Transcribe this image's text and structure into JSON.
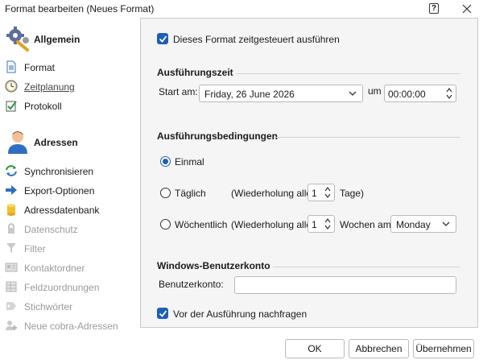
{
  "window": {
    "title": "Format bearbeiten (Neues Format)",
    "help_label": "?"
  },
  "sidebar": {
    "groups": [
      {
        "label": "Allgemein",
        "icon": "gear-wrench-icon",
        "items": [
          {
            "label": "Format",
            "icon": "document-icon",
            "state": "normal"
          },
          {
            "label": "Zeitplanung",
            "icon": "clock-icon",
            "state": "active"
          },
          {
            "label": "Protokoll",
            "icon": "checklist-icon",
            "state": "normal"
          }
        ]
      },
      {
        "label": "Adressen",
        "icon": "person-icon",
        "items": [
          {
            "label": "Synchronisieren",
            "icon": "sync-icon",
            "state": "normal"
          },
          {
            "label": "Export-Optionen",
            "icon": "arrow-right-icon",
            "state": "normal"
          },
          {
            "label": "Adressdatenbank",
            "icon": "database-icon",
            "state": "normal"
          },
          {
            "label": "Datenschutz",
            "icon": "lock-icon",
            "state": "disabled"
          },
          {
            "label": "Filter",
            "icon": "filter-icon",
            "state": "disabled"
          },
          {
            "label": "Kontaktordner",
            "icon": "contact-card-icon",
            "state": "disabled"
          },
          {
            "label": "Feldzuordnungen",
            "icon": "field-grid-icon",
            "state": "disabled"
          },
          {
            "label": "Stichwörter",
            "icon": "keyword-icon",
            "state": "disabled"
          },
          {
            "label": "Neue cobra-Adressen",
            "icon": "new-address-icon",
            "state": "disabled"
          }
        ]
      }
    ]
  },
  "content": {
    "schedule_checkbox": {
      "label": "Dieses Format zeitgesteuert ausführen",
      "checked": true
    },
    "execution_time": {
      "title": "Ausführungszeit",
      "start_label": "Start am:",
      "start_date": "Friday, 26 June 2026",
      "at_label": "um",
      "start_time": "00:00:00"
    },
    "conditions": {
      "title": "Ausführungsbedingungen",
      "once": {
        "label": "Einmal",
        "selected": true
      },
      "daily": {
        "label": "Täglich",
        "repeat_prefix": "(Wiederholung alle",
        "value": "1",
        "unit": "Tage)",
        "selected": false
      },
      "weekly": {
        "label": "Wöchentlich",
        "repeat_prefix": "(Wiederholung alle",
        "value": "1",
        "unit": "Wochen am",
        "weekday": "Monday",
        "selected": false
      }
    },
    "account": {
      "title": "Windows-Benutzerkonto",
      "user_label": "Benutzerkonto:",
      "user_value": ""
    },
    "confirm_checkbox": {
      "label": "Vor der Ausführung nachfragen",
      "checked": true
    }
  },
  "footer": {
    "ok_label": "OK",
    "cancel_label": "Abbrechen",
    "apply_label": "Übernehmen"
  },
  "colors": {
    "accent": "#1d5fb6",
    "content_bg": "#f5f5f5"
  }
}
